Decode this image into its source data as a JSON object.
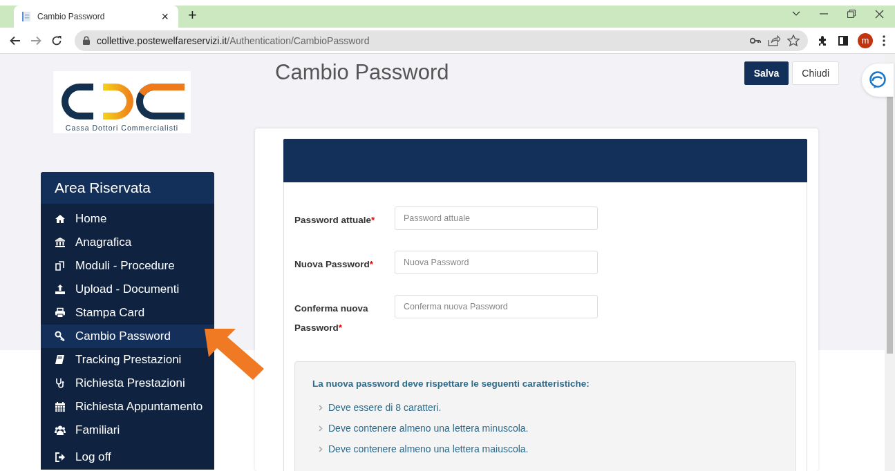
{
  "browser": {
    "tab_title": "Cambio Password",
    "tab_close": "×",
    "new_tab": "+",
    "url_host": "collettive.postewelfareservizi.it",
    "url_path": "/Authentication/CambioPassword",
    "profile_initial": "m"
  },
  "logo": {
    "caption": "Cassa Dottori Commercialisti"
  },
  "page": {
    "title": "Cambio Password",
    "buttons": [
      {
        "label": "Salva",
        "kind": "primary"
      },
      {
        "label": "Chiudi",
        "kind": "secondary"
      }
    ]
  },
  "sidebar": {
    "title": "Area Riservata",
    "items": [
      {
        "label": "Home",
        "kind": "home",
        "selected": false
      },
      {
        "label": "Anagrafica",
        "kind": "bank",
        "selected": false
      },
      {
        "label": "Moduli - Procedure",
        "kind": "copy",
        "selected": false
      },
      {
        "label": "Upload - Documenti",
        "kind": "upload",
        "selected": false
      },
      {
        "label": "Stampa Card",
        "kind": "print",
        "selected": false
      },
      {
        "label": "Cambio Password",
        "kind": "key",
        "selected": true
      },
      {
        "label": "Tracking Prestazioni",
        "kind": "book",
        "selected": false
      },
      {
        "label": "Richiesta Prestazioni",
        "kind": "stethoscope",
        "selected": false
      },
      {
        "label": "Richiesta Appuntamento",
        "kind": "calendar",
        "selected": false
      },
      {
        "label": "Familiari",
        "kind": "users",
        "selected": false
      },
      {
        "label": "Log off",
        "kind": "logout",
        "selected": false
      }
    ]
  },
  "form": {
    "fields": [
      {
        "label": "Password attuale",
        "required_mark": "*",
        "placeholder": "Password attuale"
      },
      {
        "label": "Nuova Password",
        "required_mark": "*",
        "placeholder": "Nuova Password"
      },
      {
        "label": "Conferma nuova Password",
        "required_mark": "*",
        "placeholder": "Conferma nuova Password"
      }
    ]
  },
  "rules": {
    "heading": "La nuova password deve rispettare le seguenti caratteristiche:",
    "items": [
      "Deve essere di 8 caratteri.",
      "Deve contenere almeno una lettera minuscola.",
      "Deve contenere almeno una lettera maiuscola."
    ]
  }
}
